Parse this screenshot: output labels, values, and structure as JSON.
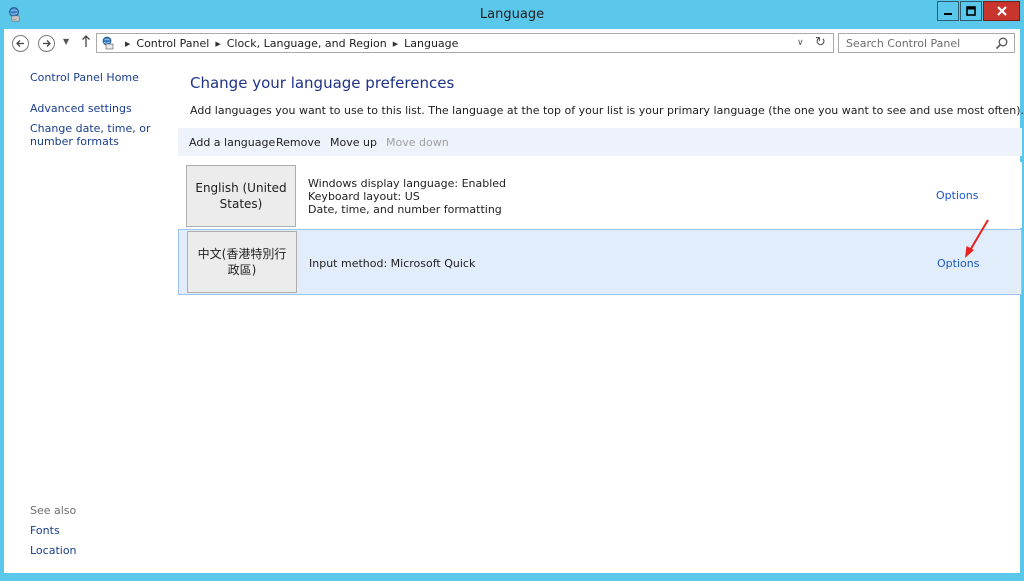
{
  "window": {
    "title": "Language",
    "accent_color": "#5bc7ea",
    "close_color": "#c7352c"
  },
  "nav": {
    "breadcrumb": [
      "Control Panel",
      "Clock, Language, and Region",
      "Language"
    ],
    "search_placeholder": "Search Control Panel"
  },
  "left_pane": {
    "home_link": "Control Panel Home",
    "advanced_link": "Advanced settings",
    "date_link": "Change date, time, or number formats",
    "see_also_label": "See also",
    "fonts_link": "Fonts",
    "location_link": "Location"
  },
  "main": {
    "heading": "Change your language preferences",
    "description": "Add languages you want to use to this list. The language at the top of your list is your primary language (the one you want to see and use most often).",
    "toolbar": {
      "add": "Add a language",
      "remove": "Remove",
      "move_up": "Move up",
      "move_down": "Move down"
    },
    "languages": [
      {
        "name": "English (United States)",
        "details": [
          "Windows display language: Enabled",
          "Keyboard layout: US",
          "Date, time, and number formatting"
        ],
        "options": "Options"
      },
      {
        "name": "中文(香港特別行政區)",
        "details": [
          "Input method: Microsoft Quick"
        ],
        "options": "Options"
      }
    ]
  },
  "icons": {
    "app": "control-panel-icon",
    "back": "back-arrow-icon",
    "forward": "forward-arrow-icon",
    "up": "up-arrow-icon",
    "refresh": "refresh-icon",
    "search": "search-icon",
    "annotation": "red-arrow-annotation"
  },
  "colors": {
    "link": "#1a3d8f",
    "heading": "#1e3287",
    "selected_row": "#e2edfb",
    "annotation": "#e8211e"
  }
}
